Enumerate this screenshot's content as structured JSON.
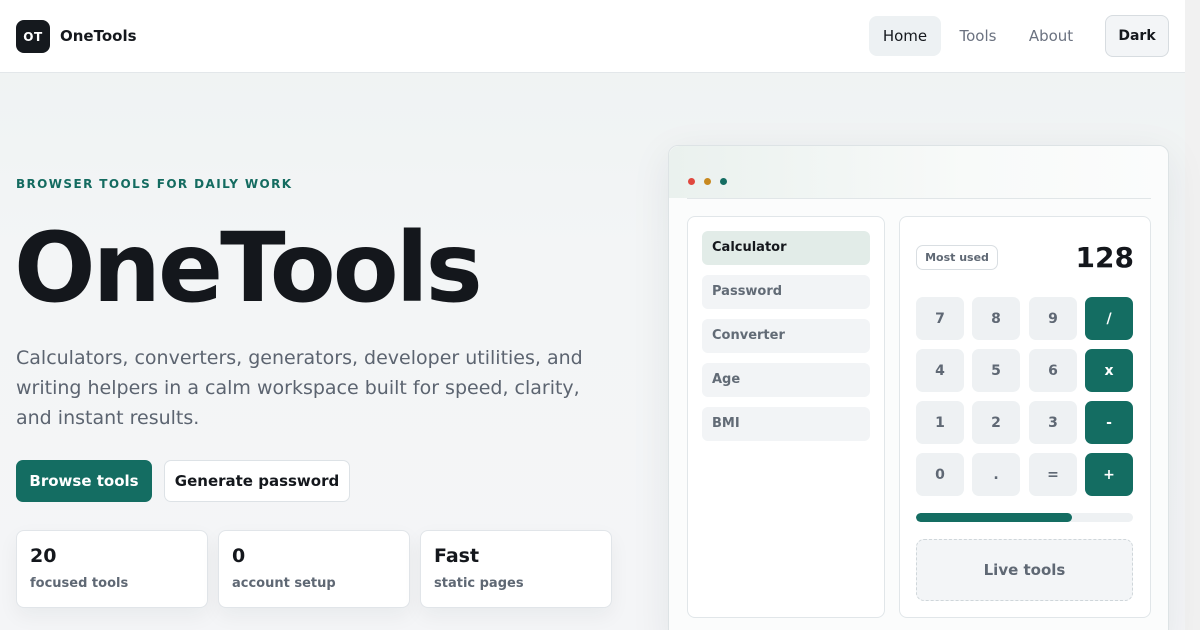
{
  "header": {
    "logo_initials": "OT",
    "brand": "OneTools",
    "nav": {
      "home": "Home",
      "tools": "Tools",
      "about": "About"
    },
    "theme_toggle": "Dark"
  },
  "hero": {
    "eyebrow": "BROWSER TOOLS FOR DAILY WORK",
    "title": "OneTools",
    "description": "Calculators, converters, generators, developer utilities, and writing helpers in a calm workspace built for speed, clarity, and instant results.",
    "primary_button": "Browse tools",
    "secondary_button": "Generate password",
    "stats": [
      {
        "value": "20",
        "label": "focused tools"
      },
      {
        "value": "0",
        "label": "account setup"
      },
      {
        "value": "Fast",
        "label": "static pages"
      }
    ]
  },
  "preview": {
    "window_dots": [
      "#e0483e",
      "#c8891f",
      "#146d62"
    ],
    "menu": [
      "Calculator",
      "Password",
      "Converter",
      "Age",
      "BMI"
    ],
    "active_menu": "Calculator",
    "chip": "Most used",
    "display": "128",
    "keys": [
      [
        "7",
        "8",
        "9",
        "/"
      ],
      [
        "4",
        "5",
        "6",
        "x"
      ],
      [
        "1",
        "2",
        "3",
        "-"
      ],
      [
        "0",
        ".",
        "=",
        "+"
      ]
    ],
    "progress_percent": 72,
    "live_label": "Live tools"
  },
  "colors": {
    "accent": "#146d62",
    "ink": "#14171c",
    "muted": "#5f6874"
  }
}
